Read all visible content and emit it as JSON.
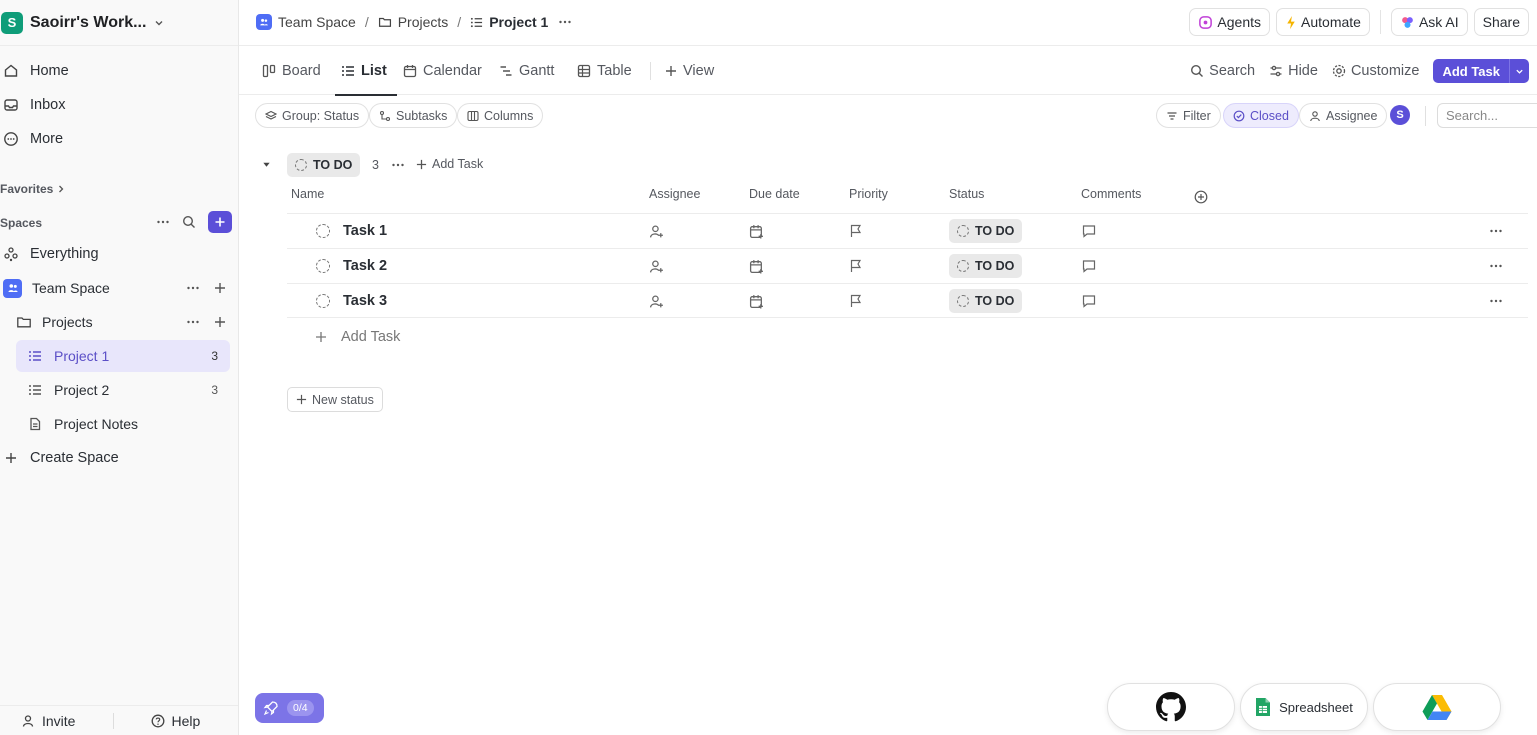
{
  "workspace": {
    "initial": "S",
    "name": "Saoirr's Work..."
  },
  "sidebar": {
    "nav": [
      {
        "label": "Home",
        "icon": "home-icon"
      },
      {
        "label": "Inbox",
        "icon": "inbox-icon"
      },
      {
        "label": "More",
        "icon": "more-circle-icon"
      }
    ],
    "favorites_label": "Favorites",
    "spaces_label": "Spaces",
    "everything_label": "Everything",
    "team_space": "Team Space",
    "folder": "Projects",
    "lists": [
      {
        "label": "Project 1",
        "count": "3",
        "active": true
      },
      {
        "label": "Project 2",
        "count": "3",
        "active": false
      }
    ],
    "doc": "Project Notes",
    "create_space": "Create Space",
    "invite": "Invite",
    "help": "Help"
  },
  "breadcrumb": {
    "space": "Team Space",
    "folder": "Projects",
    "list": "Project 1",
    "sep": "/"
  },
  "top_actions": {
    "agents": "Agents",
    "automate": "Automate",
    "ask_ai": "Ask AI",
    "share": "Share"
  },
  "views": {
    "tabs": [
      {
        "label": "Board",
        "icon": "board-icon"
      },
      {
        "label": "List",
        "icon": "list-icon"
      },
      {
        "label": "Calendar",
        "icon": "calendar-icon"
      },
      {
        "label": "Gantt",
        "icon": "gantt-icon"
      },
      {
        "label": "Table",
        "icon": "table-icon"
      }
    ],
    "active_tab": "List",
    "add_view": "View",
    "search": "Search",
    "hide": "Hide",
    "customize": "Customize",
    "add_task": "Add Task"
  },
  "filters": {
    "group": "Group: Status",
    "subtasks": "Subtasks",
    "columns": "Columns",
    "filter": "Filter",
    "closed": "Closed",
    "assignee": "Assignee",
    "user_initial": "S",
    "search_placeholder": "Search..."
  },
  "group": {
    "status": "TO DO",
    "count": "3",
    "add_task": "Add Task"
  },
  "columns": [
    "Name",
    "Assignee",
    "Due date",
    "Priority",
    "Status",
    "Comments"
  ],
  "tasks": [
    {
      "name": "Task 1",
      "status": "TO DO"
    },
    {
      "name": "Task 2",
      "status": "TO DO"
    },
    {
      "name": "Task 3",
      "status": "TO DO"
    }
  ],
  "add_task_row": "Add Task",
  "new_status": "New status",
  "onboarding": {
    "progress": "0/4"
  },
  "dock": {
    "github": "github-icon",
    "spreadsheet": "Spreadsheet",
    "drive": "google-drive-icon"
  },
  "colors": {
    "accent": "#5b4fd8",
    "workspace": "#0f9d79",
    "active_bg": "#e8e6fb"
  }
}
